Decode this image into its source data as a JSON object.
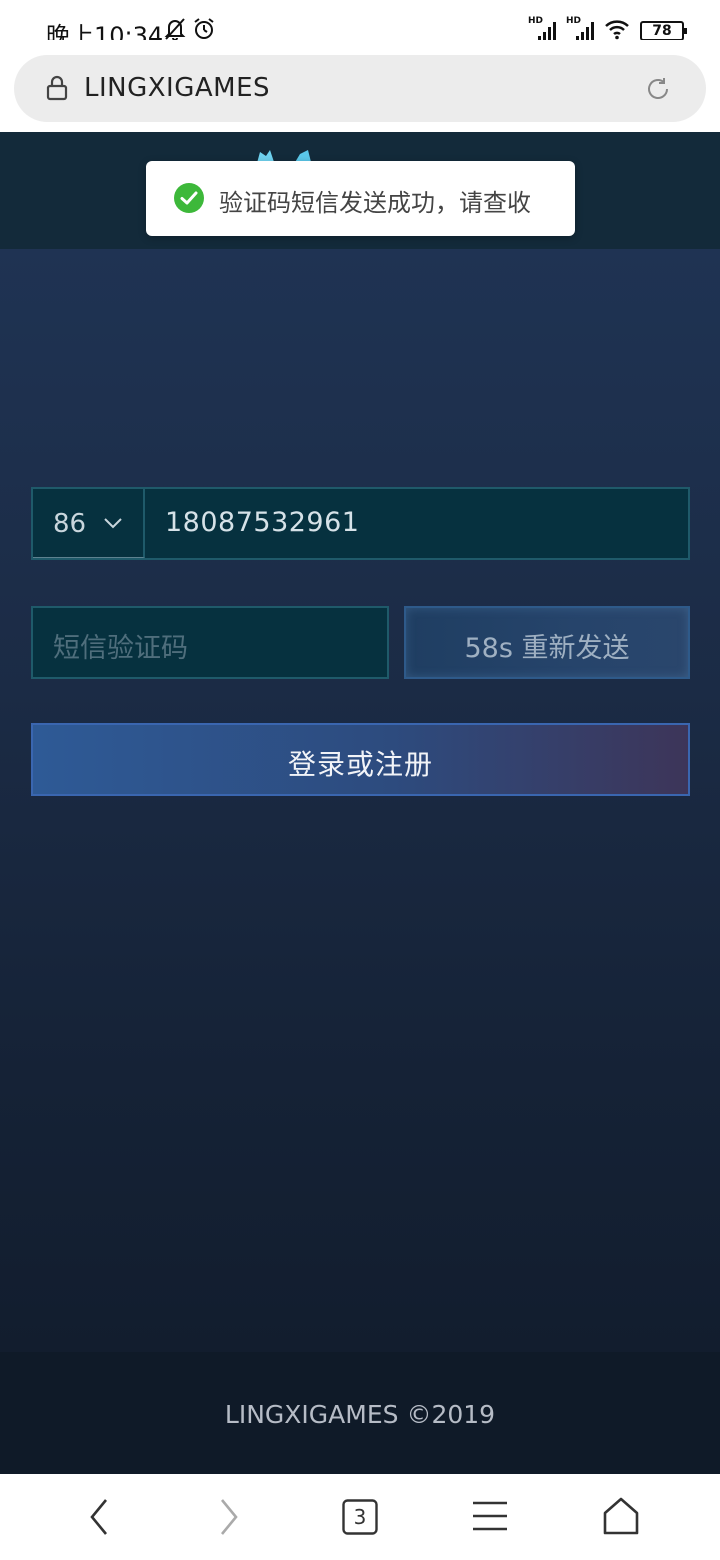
{
  "status_bar": {
    "time": "晚上10:34",
    "signal_label_1": "HD",
    "signal_label_2": "HD",
    "battery": "78"
  },
  "browser": {
    "address": "LINGXIGAMES",
    "tabs_count": "3"
  },
  "toast": {
    "message": "验证码短信发送成功，请查收",
    "icon": "check-circle-icon",
    "icon_color": "#3db83a"
  },
  "form": {
    "country_code": "86",
    "phone_number": "18087532961",
    "code_placeholder": "短信验证码",
    "resend_label": "58s 重新发送",
    "login_label": "登录或注册"
  },
  "footer": {
    "copyright": "LINGXIGAMES ©2019"
  },
  "colors": {
    "accent_border": "#1f5a6a",
    "login_gradient_start": "#2e5a96",
    "login_gradient_end": "#3d3559"
  }
}
